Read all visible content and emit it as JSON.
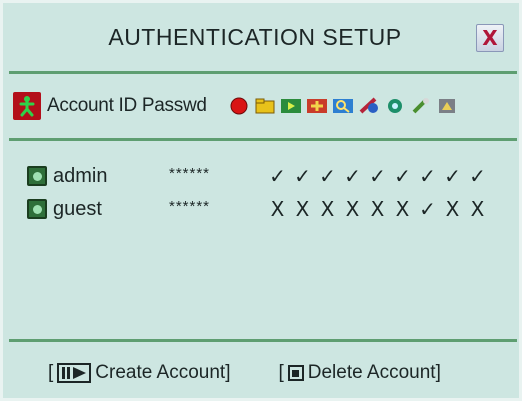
{
  "dialog": {
    "title": "AUTHENTICATION SETUP",
    "close_label": "X"
  },
  "header": {
    "columns_label": "Account ID Passwd",
    "permission_icons": [
      "record-icon",
      "folder-icon",
      "playback-icon",
      "alarm-icon",
      "search-icon",
      "network-icon",
      "ptz-icon",
      "tools-icon",
      "system-icon"
    ]
  },
  "accounts": [
    {
      "id": "admin",
      "password": "******",
      "permissions": [
        "✓",
        "✓",
        "✓",
        "✓",
        "✓",
        "✓",
        "✓",
        "✓",
        "✓"
      ]
    },
    {
      "id": "guest",
      "password": "******",
      "permissions": [
        "X",
        "X",
        "X",
        "X",
        "X",
        "X",
        "✓",
        "X",
        "X"
      ]
    }
  ],
  "footer": {
    "create_open": "[",
    "create_label": "Create Account]",
    "delete_open": "[",
    "delete_label": "Delete Account]"
  },
  "colors": {
    "background": "#cde6e1",
    "separator": "#5e9e71",
    "close_x": "#b0153a"
  }
}
